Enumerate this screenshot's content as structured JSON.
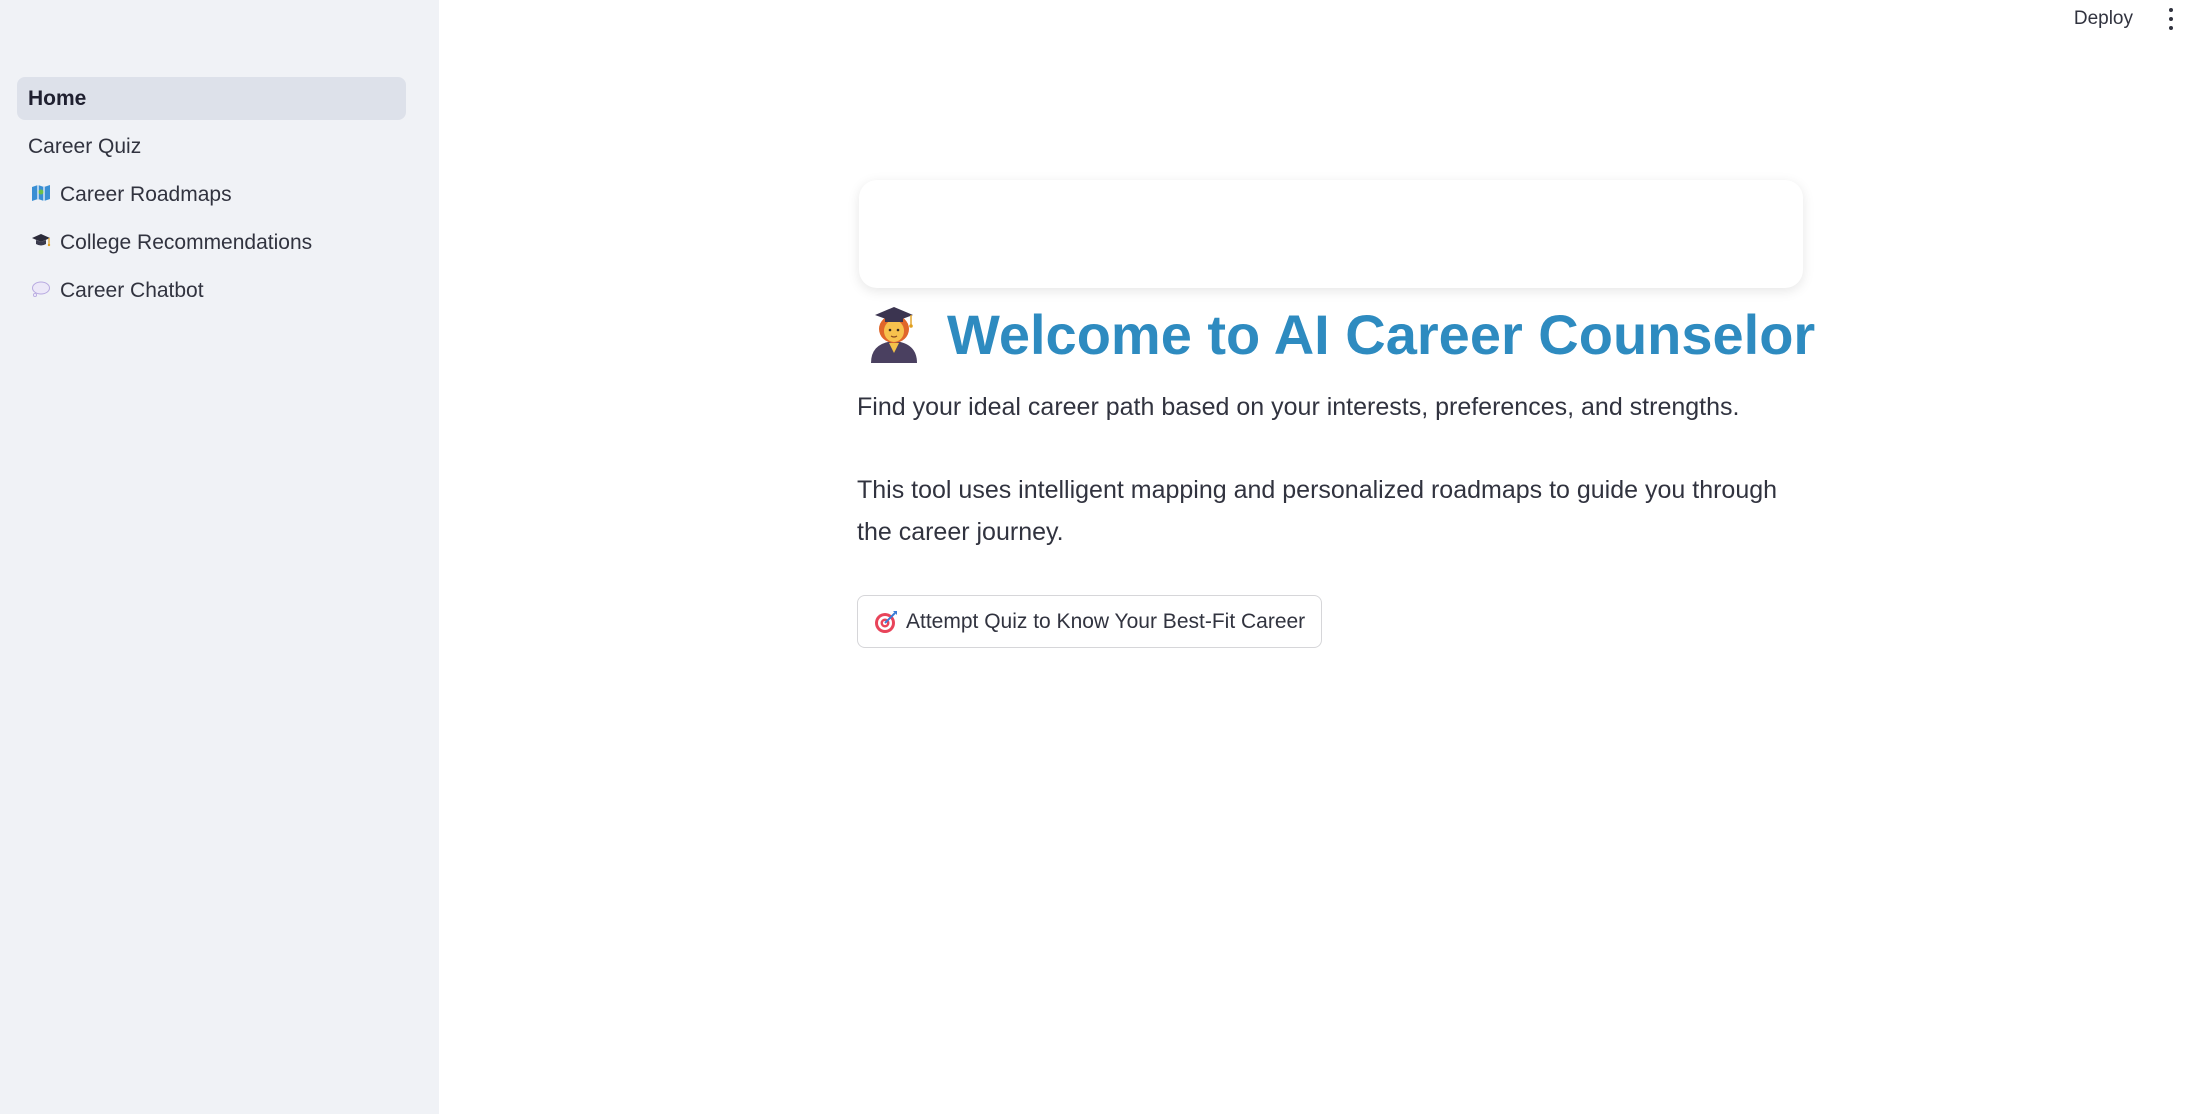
{
  "sidebar": {
    "items": [
      {
        "label": "Home",
        "icon": "",
        "active": true
      },
      {
        "label": "Career Quiz",
        "icon": ""
      },
      {
        "label": "Career Roadmaps",
        "icon": "map-icon"
      },
      {
        "label": "College Recommendations",
        "icon": "graduation-cap-icon"
      },
      {
        "label": "Career Chatbot",
        "icon": "speech-bubble-icon"
      }
    ]
  },
  "header": {
    "deploy_label": "Deploy",
    "menu_icon": "vertical-dots-icon"
  },
  "main": {
    "title_icon": "graduate-person-icon",
    "title": "Welcome to AI Career Counselor",
    "paragraph1": "Find your ideal career path based on your interests, preferences, and strengths.",
    "paragraph2": "This tool uses intelligent mapping and personalized roadmaps to guide you through the career journey.",
    "quiz_button": {
      "icon": "target-icon",
      "label": "Attempt Quiz to Know Your Best-Fit Career"
    }
  },
  "colors": {
    "sidebar_bg": "#f0f2f6",
    "active_item_bg": "#dde1ea",
    "title": "#2e8bc0",
    "text": "#31333f"
  }
}
